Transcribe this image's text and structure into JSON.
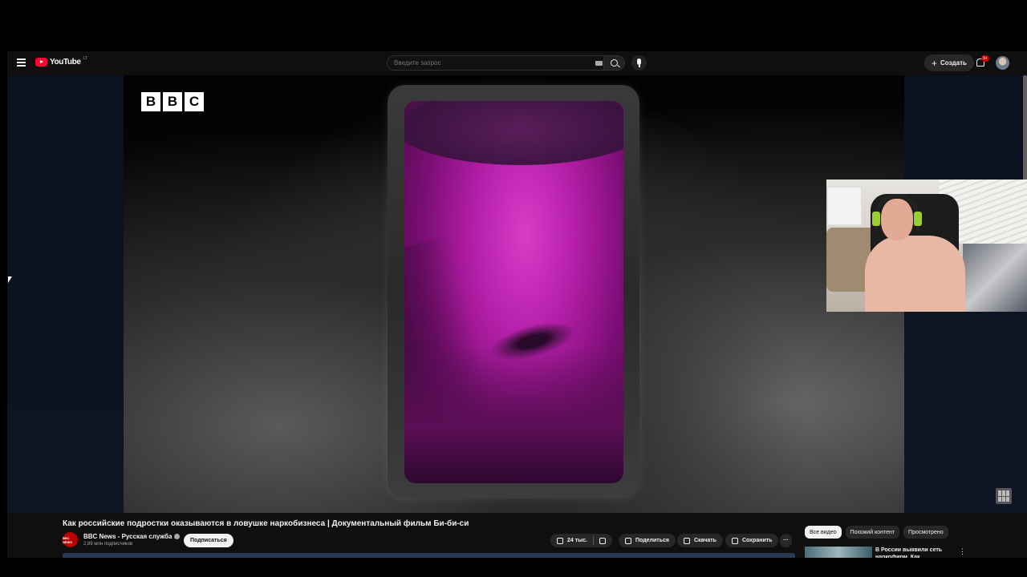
{
  "header": {
    "logo_text": "YouTube",
    "logo_sup": "LT",
    "search_placeholder": "Введите запрос",
    "create_label": "Создать",
    "notifications_badge": "9+"
  },
  "video": {
    "bbc_letters": [
      "B",
      "B",
      "C"
    ]
  },
  "info": {
    "title": "Как российские подростки оказываются в ловушке наркобизнеса | Документальный фильм Би-би-си",
    "channel_name": "BBC News - Русская служба",
    "channel_avatar_text": "BBC NEWS",
    "subscribers": "2,89 млн подписчиков",
    "subscribe_label": "Подписаться",
    "likes": "24 тыс.",
    "share_label": "Поделиться",
    "download_label": "Скачать",
    "save_label": "Сохранить",
    "more_label": "···"
  },
  "related": {
    "chips": [
      "Все видео",
      "Похожий контент",
      "Просмотрено"
    ],
    "first_video_title": "В России выявили сеть наркофирм. Как вычислить...",
    "more_label": "⋮"
  },
  "colors": {
    "brand_red": "#ff0033",
    "bg": "#0f0f0f",
    "chip_bg": "#272727"
  }
}
